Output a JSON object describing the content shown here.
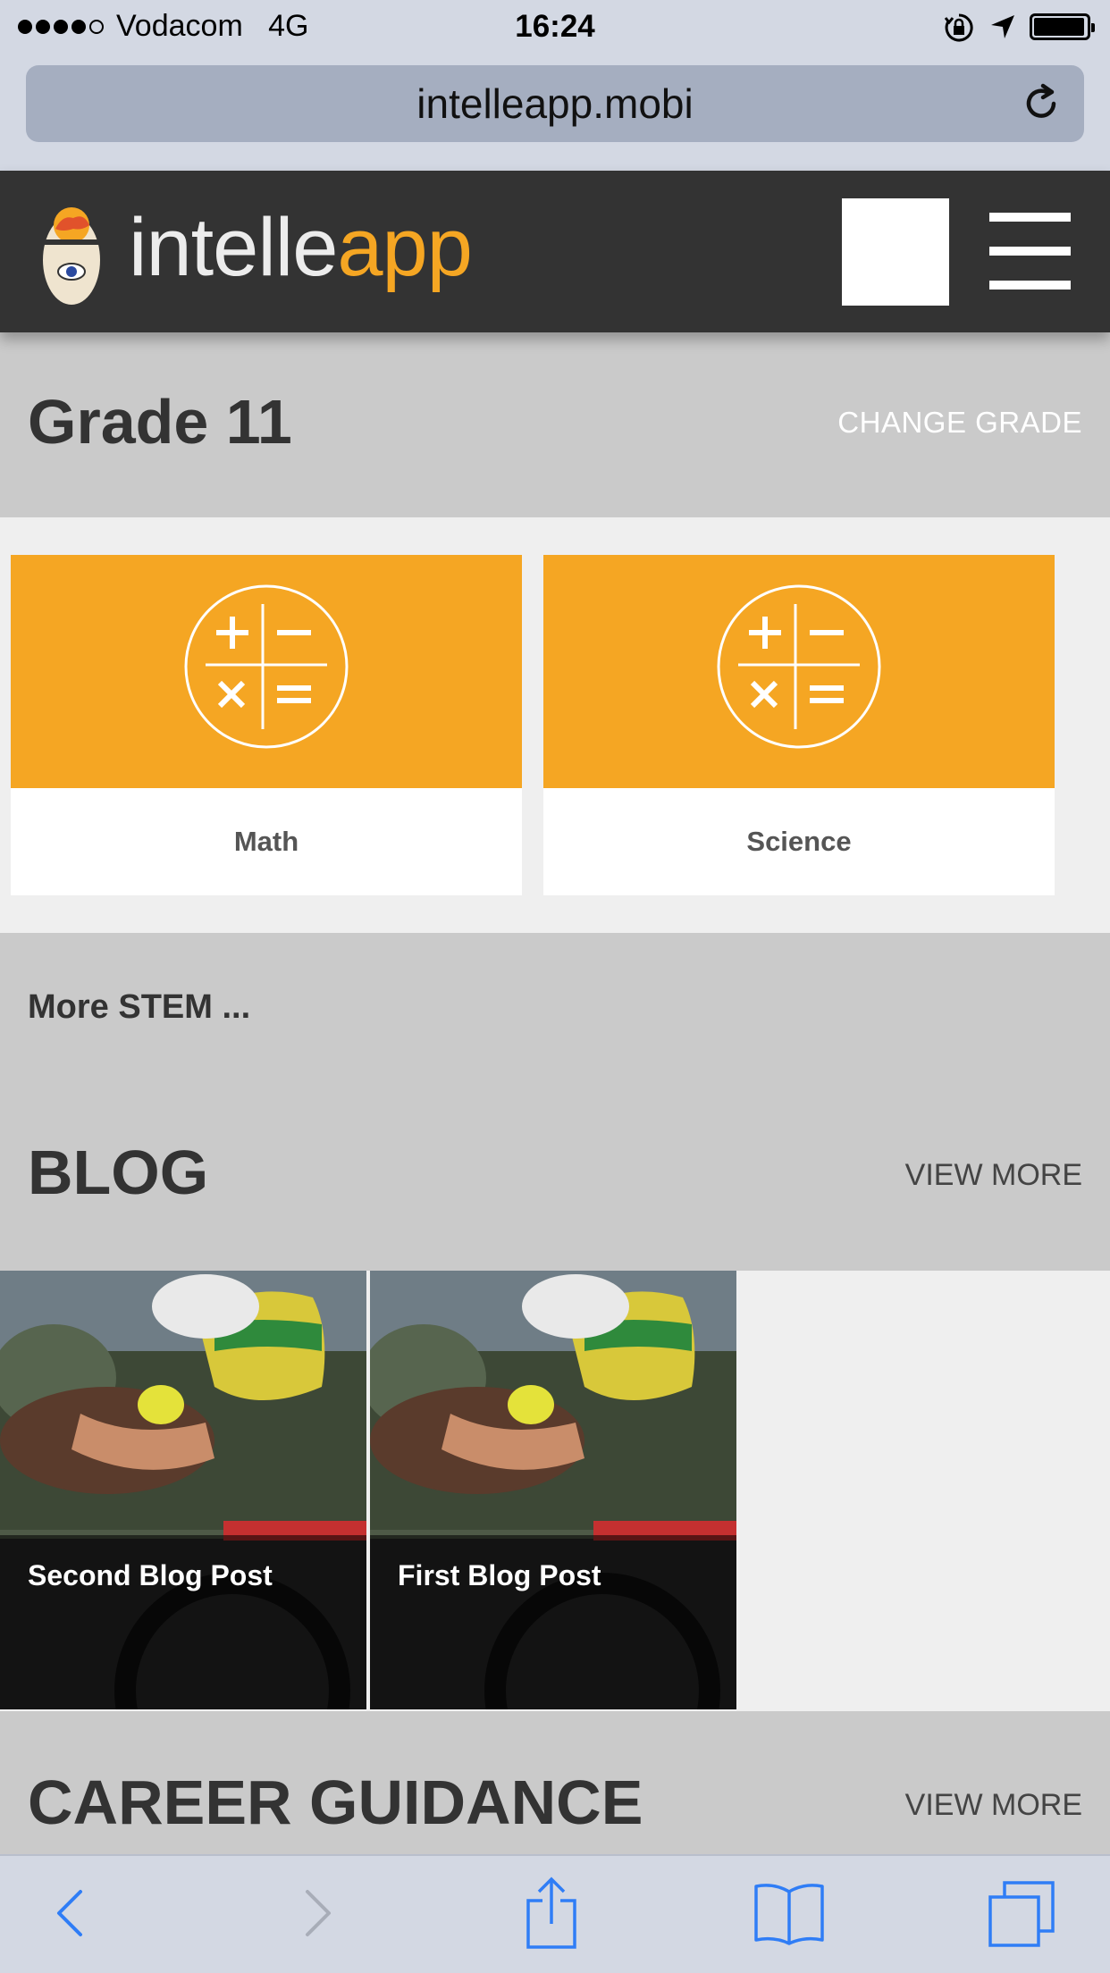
{
  "status_bar": {
    "carrier": "Vodacom",
    "network": "4G",
    "time": "16:24"
  },
  "browser": {
    "url": "intelleapp.mobi"
  },
  "app_header": {
    "logo_part1": "intelle",
    "logo_part2": "app"
  },
  "grade": {
    "title": "Grade 11",
    "change_label": "CHANGE GRADE"
  },
  "subjects": [
    {
      "label": "Math",
      "icon": "calculator-icon"
    },
    {
      "label": "Science",
      "icon": "calculator-icon"
    }
  ],
  "more_stem": "More STEM ...",
  "blog": {
    "title": "BLOG",
    "view_more": "VIEW MORE",
    "posts": [
      {
        "title": "Second Blog Post"
      },
      {
        "title": "First Blog Post"
      }
    ]
  },
  "career": {
    "title": "CAREER GUIDANCE",
    "view_more": "VIEW MORE"
  },
  "colors": {
    "accent": "#f5a623",
    "header_bg": "#333333",
    "section_gray": "#cacaca",
    "safari_chrome": "#d3d8e3",
    "ios_blue": "#2f7df6"
  }
}
